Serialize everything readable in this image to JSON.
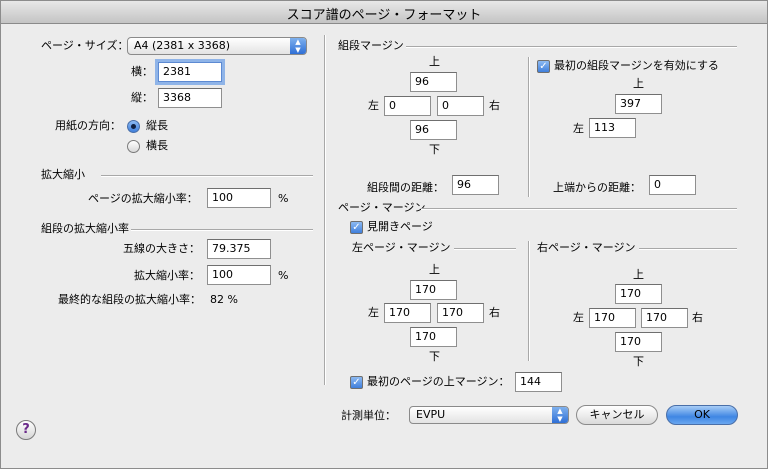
{
  "window": {
    "title": "スコア譜のページ・フォーマット"
  },
  "page_size": {
    "label": "ページ・サイズ：",
    "value": "A4 (2381 x 3368)",
    "width_label": "横：",
    "width_value": "2381",
    "height_label": "縦：",
    "height_value": "3368",
    "orientation_label": "用紙の方向：",
    "portrait": "縦長",
    "landscape": "横長",
    "selected": "縦長"
  },
  "scaling": {
    "header": "拡大縮小",
    "page_scale_label": "ページの拡大縮小率：",
    "page_scale_value": "100",
    "unit": "%"
  },
  "system_scaling": {
    "header": "組段の拡大縮小率",
    "staff_size_label": "五線の大きさ：",
    "staff_size_value": "79.375",
    "scale_label": "拡大縮小率：",
    "scale_value": "100",
    "unit": "%",
    "final_label": "最終的な組段の拡大縮小率：",
    "final_value": "82 %"
  },
  "system_margins": {
    "header": "組段マージン",
    "top_label": "上",
    "top": "96",
    "left_label": "左",
    "left": "0",
    "right": "0",
    "right_label": "右",
    "bottom": "96",
    "bottom_label": "下",
    "between_label": "組段間の距離：",
    "between_value": "96",
    "first_enable_label": "最初の組段マージンを有効にする",
    "first_enabled": true,
    "first_top_label": "上",
    "first_top": "397",
    "first_left_label": "左",
    "first_left": "113",
    "top_distance_label": "上端からの距離：",
    "top_distance_value": "0"
  },
  "page_margins": {
    "header": "ページ・マージン",
    "facing_label": "見開きページ",
    "facing_enabled": true,
    "left_page": {
      "header": "左ページ・マージン",
      "top_label": "上",
      "top": "170",
      "left_label": "左",
      "left": "170",
      "right": "170",
      "right_label": "右",
      "bottom": "170",
      "bottom_label": "下"
    },
    "right_page": {
      "header": "右ページ・マージン",
      "top_label": "上",
      "top": "170",
      "left_label": "左",
      "left": "170",
      "right": "170",
      "right_label": "右",
      "bottom": "170",
      "bottom_label": "下"
    },
    "first_top_label": "最初のページの上マージン：",
    "first_top_enabled": true,
    "first_top_value": "144"
  },
  "footer": {
    "unit_label": "計測単位：",
    "unit_value": "EVPU",
    "cancel": "キャンセル",
    "ok": "OK",
    "help": "?"
  }
}
